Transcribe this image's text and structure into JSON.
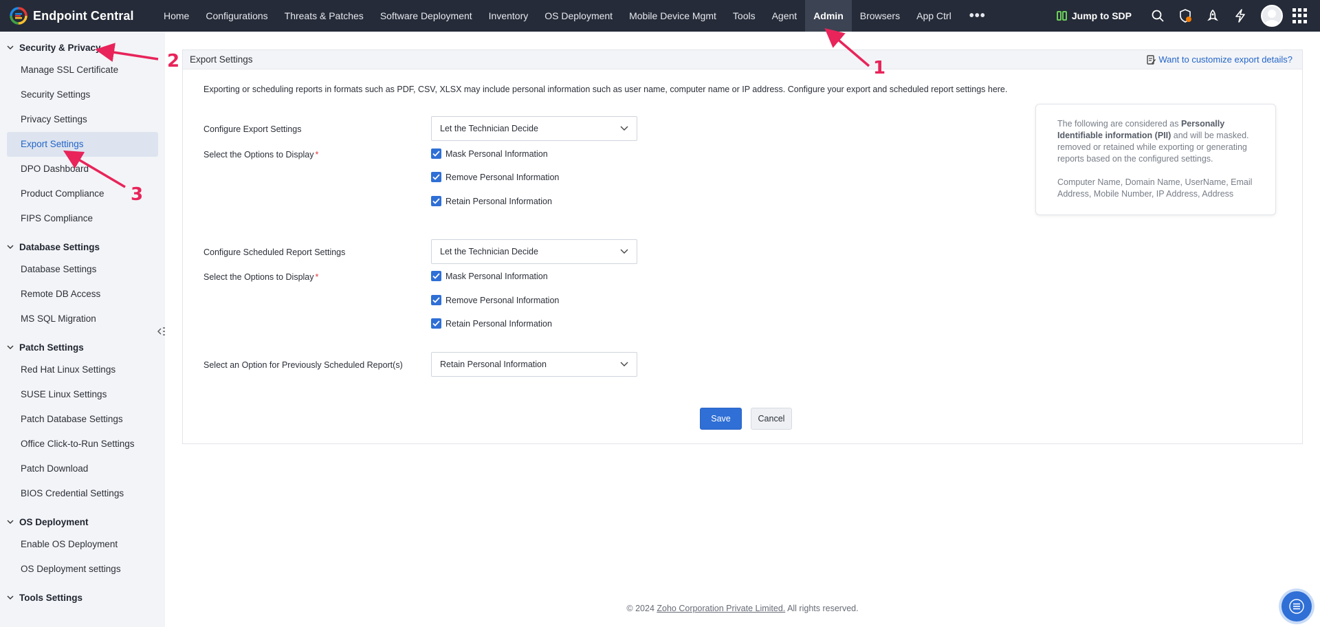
{
  "app": {
    "brand": "Endpoint Central",
    "brand_colors": [
      "#1e88e5",
      "#e53935",
      "#fbc02d",
      "#43a047"
    ]
  },
  "nav": {
    "items": [
      "Home",
      "Configurations",
      "Threats & Patches",
      "Software Deployment",
      "Inventory",
      "OS Deployment",
      "Mobile Device Mgmt",
      "Tools",
      "Agent",
      "Admin",
      "Browsers",
      "App Ctrl"
    ],
    "active": "Admin",
    "more_icon": "more-dots-icon",
    "jump_label": "Jump to SDP"
  },
  "sidebar": {
    "groups": [
      {
        "title": "Security & Privacy",
        "items": [
          "Manage SSL Certificate",
          "Security Settings",
          "Privacy Settings",
          "Export Settings",
          "DPO Dashboard",
          "Product Compliance",
          "FIPS Compliance"
        ]
      },
      {
        "title": "Database Settings",
        "items": [
          "Database Settings",
          "Remote DB Access",
          "MS SQL Migration"
        ]
      },
      {
        "title": "Patch Settings",
        "items": [
          "Red Hat Linux Settings",
          "SUSE Linux Settings",
          "Patch Database Settings",
          "Office Click-to-Run Settings",
          "Patch Download",
          "BIOS Credential Settings"
        ]
      },
      {
        "title": "OS Deployment",
        "items": [
          "Enable OS Deployment",
          "OS Deployment settings"
        ]
      },
      {
        "title": "Tools Settings",
        "items": []
      }
    ],
    "active_item": "Export Settings"
  },
  "panel": {
    "title": "Export Settings",
    "customize_link": "Want to customize export details?",
    "intro": "Exporting or scheduling reports in formats such as PDF, CSV, XLSX may include personal information such as user name, computer name or IP address. Configure your export and scheduled report settings here.",
    "export": {
      "label": "Configure Export Settings",
      "value": "Let the Technician Decide",
      "options_label": "Select the Options to Display",
      "options": [
        "Mask Personal Information",
        "Remove Personal Information",
        "Retain Personal Information"
      ]
    },
    "scheduled": {
      "label": "Configure Scheduled Report Settings",
      "value": "Let the Technician Decide",
      "options_label": "Select the Options to Display",
      "options": [
        "Mask Personal Information",
        "Remove Personal Information",
        "Retain Personal Information"
      ]
    },
    "previous": {
      "label": "Select an Option for Previously Scheduled Report(s)",
      "value": "Retain Personal Information"
    },
    "info": {
      "line1_pre": "The following are considered as ",
      "line1_bold": "Personally Identifiable information (PII)",
      "line1_post": " and will be masked. removed or retained while exporting or generating reports based on the configured settings.",
      "line2": "Computer Name, Domain Name, UserName, Email Address, Mobile Number, IP Address, Address"
    },
    "save_label": "Save",
    "cancel_label": "Cancel"
  },
  "footer": {
    "pre": "© 2024 ",
    "link": "Zoho Corporation Private Limited.",
    "post": " All rights reserved."
  },
  "annotations": {
    "color": "#e8245a",
    "labels": [
      "1",
      "2",
      "3"
    ]
  },
  "colors": {
    "topbar": "#252b38",
    "accent": "#2f6fd6",
    "active_item_bg": "#dde4ef",
    "required": "#e0383e"
  }
}
